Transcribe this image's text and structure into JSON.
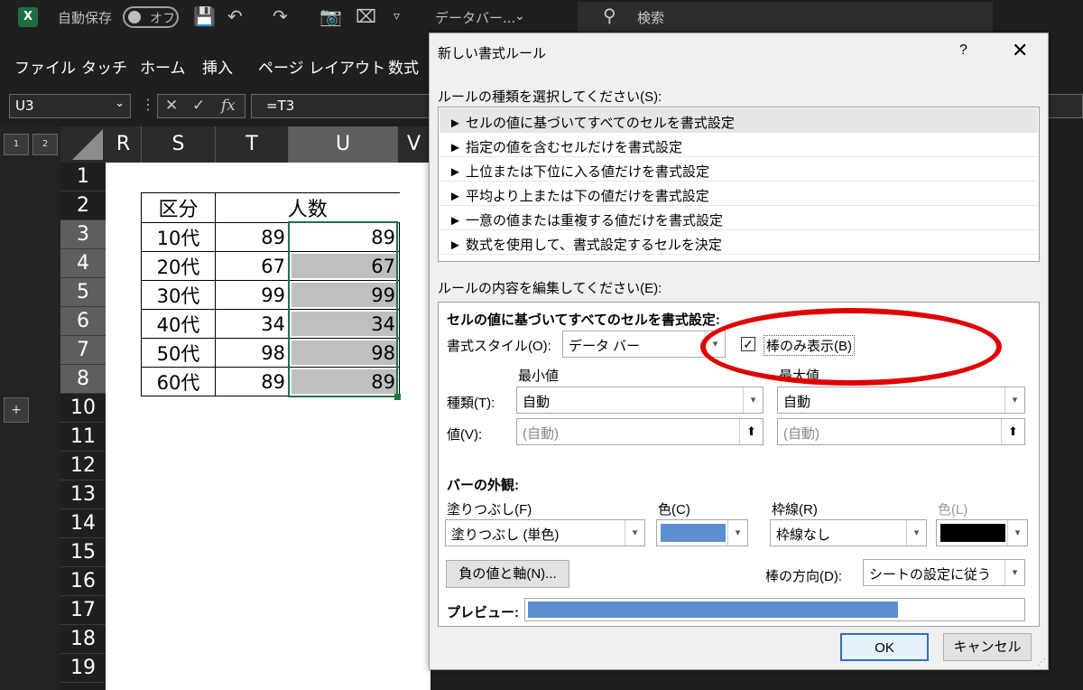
{
  "titlebar": {
    "app_logo": "X",
    "autosave_label": "自動保存",
    "autosave_state": "オフ",
    "doc_name": "データバー...",
    "search_placeholder": "検索"
  },
  "ribbon": {
    "tabs": [
      "ファイル",
      "タッチ",
      "ホーム",
      "挿入",
      "ページ レイアウト",
      "数式"
    ]
  },
  "formula_bar": {
    "name_box": "U3",
    "formula": "=T3",
    "fx_label": "fx"
  },
  "outline": {
    "levels": [
      "1",
      "2"
    ],
    "expand": "+"
  },
  "sheet": {
    "columns": [
      "R",
      "S",
      "T",
      "U",
      "V"
    ],
    "rows": [
      "1",
      "2",
      "3",
      "4",
      "5",
      "6",
      "7",
      "8",
      "10",
      "11",
      "12",
      "13",
      "14",
      "15",
      "16",
      "17",
      "18",
      "19"
    ],
    "table": {
      "header_category": "区分",
      "header_count": "人数",
      "rows": [
        {
          "category": "10代",
          "value": "89",
          "bar_value": "89",
          "bar_fraction": 0
        },
        {
          "category": "20代",
          "value": "67",
          "bar_value": "67",
          "bar_fraction": 1
        },
        {
          "category": "30代",
          "value": "99",
          "bar_value": "99",
          "bar_fraction": 1
        },
        {
          "category": "40代",
          "value": "34",
          "bar_value": "34",
          "bar_fraction": 1
        },
        {
          "category": "50代",
          "value": "98",
          "bar_value": "98",
          "bar_fraction": 1
        },
        {
          "category": "60代",
          "value": "89",
          "bar_value": "89",
          "bar_fraction": 1
        }
      ]
    }
  },
  "dialog": {
    "title": "新しい書式ルール",
    "help": "?",
    "close": "✕",
    "rule_type_label": "ルールの種類を選択してください(S):",
    "rule_types": [
      "► セルの値に基づいてすべてのセルを書式設定",
      "► 指定の値を含むセルだけを書式設定",
      "► 上位または下位に入る値だけを書式設定",
      "► 平均より上または下の値だけを書式設定",
      "► 一意の値または重複する値だけを書式設定",
      "► 数式を使用して、書式設定するセルを決定"
    ],
    "edit_label": "ルールの内容を編集してください(E):",
    "edit_heading": "セルの値に基づいてすべてのセルを書式設定:",
    "format_style_label": "書式スタイル(O):",
    "format_style_value": "データ バー",
    "bar_only_label": "棒のみ表示(B)",
    "bar_only_checked": "✓",
    "min_label": "最小値",
    "max_label": "最大値",
    "type_label": "種類(T):",
    "value_label": "値(V):",
    "min_type": "自動",
    "max_type": "自動",
    "min_value": "(自動)",
    "max_value": "(自動)",
    "bar_appearance_label": "バーの外観:",
    "fill_label": "塗りつぶし(F)",
    "fill_value": "塗りつぶし (単色)",
    "color_label": "色(C)",
    "fill_color": "#5b8fcf",
    "border_label": "枠線(R)",
    "border_value": "枠線なし",
    "border_color_label": "色(L)",
    "border_color": "#000000",
    "negative_button": "負の値と軸(N)...",
    "direction_label": "棒の方向(D):",
    "direction_value": "シートの設定に従う",
    "preview_label": "プレビュー:",
    "preview_fraction": 0.75,
    "ok": "OK",
    "cancel": "キャンセル"
  }
}
